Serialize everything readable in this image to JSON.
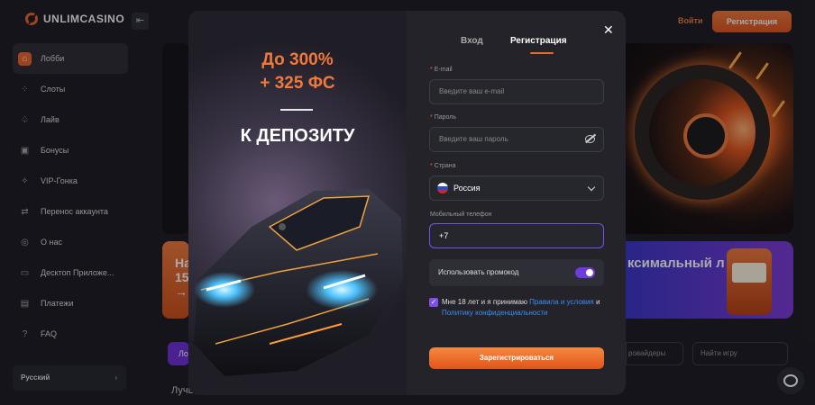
{
  "header": {
    "logo_text": "UNLIMCASINO",
    "login_label": "Войти",
    "register_label": "Регистрация"
  },
  "sidebar": {
    "items": [
      {
        "label": "Лобби",
        "icon": "home-icon"
      },
      {
        "label": "Слоты",
        "icon": "slots-icon"
      },
      {
        "label": "Лайв",
        "icon": "spade-icon"
      },
      {
        "label": "Бонусы",
        "icon": "gift-icon"
      },
      {
        "label": "VIP-Гонка",
        "icon": "vip-icon"
      },
      {
        "label": "Перенос аккаунта",
        "icon": "transfer-icon"
      },
      {
        "label": "О нас",
        "icon": "info-icon"
      },
      {
        "label": "Десктоп Приложе...",
        "icon": "desktop-icon"
      },
      {
        "label": "Платежи",
        "icon": "wallet-icon"
      },
      {
        "label": "FAQ",
        "icon": "question-icon"
      }
    ],
    "language": "Русский"
  },
  "background": {
    "promo_banner_text": "На 15 →",
    "filter_label": "Ло",
    "section_title": "Лучш",
    "slots_banner_text": "ксимальный л",
    "providers_label": "ровайдеры",
    "search_placeholder": "Найти игру"
  },
  "modal": {
    "promo": {
      "line1": "До 300%",
      "line2": "+ 325 ФС",
      "line3": "К ДЕПОЗИТУ"
    },
    "tabs": {
      "login": "Вход",
      "register": "Регистрация"
    },
    "close_symbol": "✕",
    "email": {
      "label": "E-mail",
      "placeholder": "Введите ваш e-mail"
    },
    "password": {
      "label": "Пароль",
      "placeholder": "Введите ваш пароль"
    },
    "country": {
      "label": "Страна",
      "value": "Россия"
    },
    "phone": {
      "label": "Мобильный телефон",
      "value": "+7"
    },
    "promo_code_label": "Использовать промокод",
    "agreement": {
      "prefix": "Мне 18 лет и я принимаю ",
      "link1": "Правила и условия",
      "conj": " и ",
      "link2": "Политику конфиденциальности"
    },
    "submit_label": "Зарегистрироваться"
  },
  "colors": {
    "accent": "#f0652a",
    "focus": "#7a4ff0",
    "link": "#3c8ef5"
  }
}
